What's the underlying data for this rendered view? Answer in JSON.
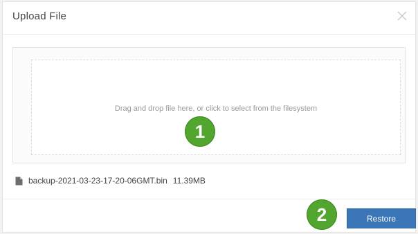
{
  "dialog": {
    "title": "Upload File"
  },
  "dropzone": {
    "text": "Drag and drop file here, or click to select from the filesystem"
  },
  "file": {
    "name": "backup-2021-03-23-17-20-06GMT.bin",
    "size": "11.39MB"
  },
  "footer": {
    "restore_label": "Restore"
  },
  "markers": {
    "step1": "1",
    "step2": "2"
  },
  "colors": {
    "primary_button": "#3a76b8",
    "marker": "#52a52e"
  },
  "icons": {
    "close": "close-icon",
    "file": "file-icon"
  }
}
